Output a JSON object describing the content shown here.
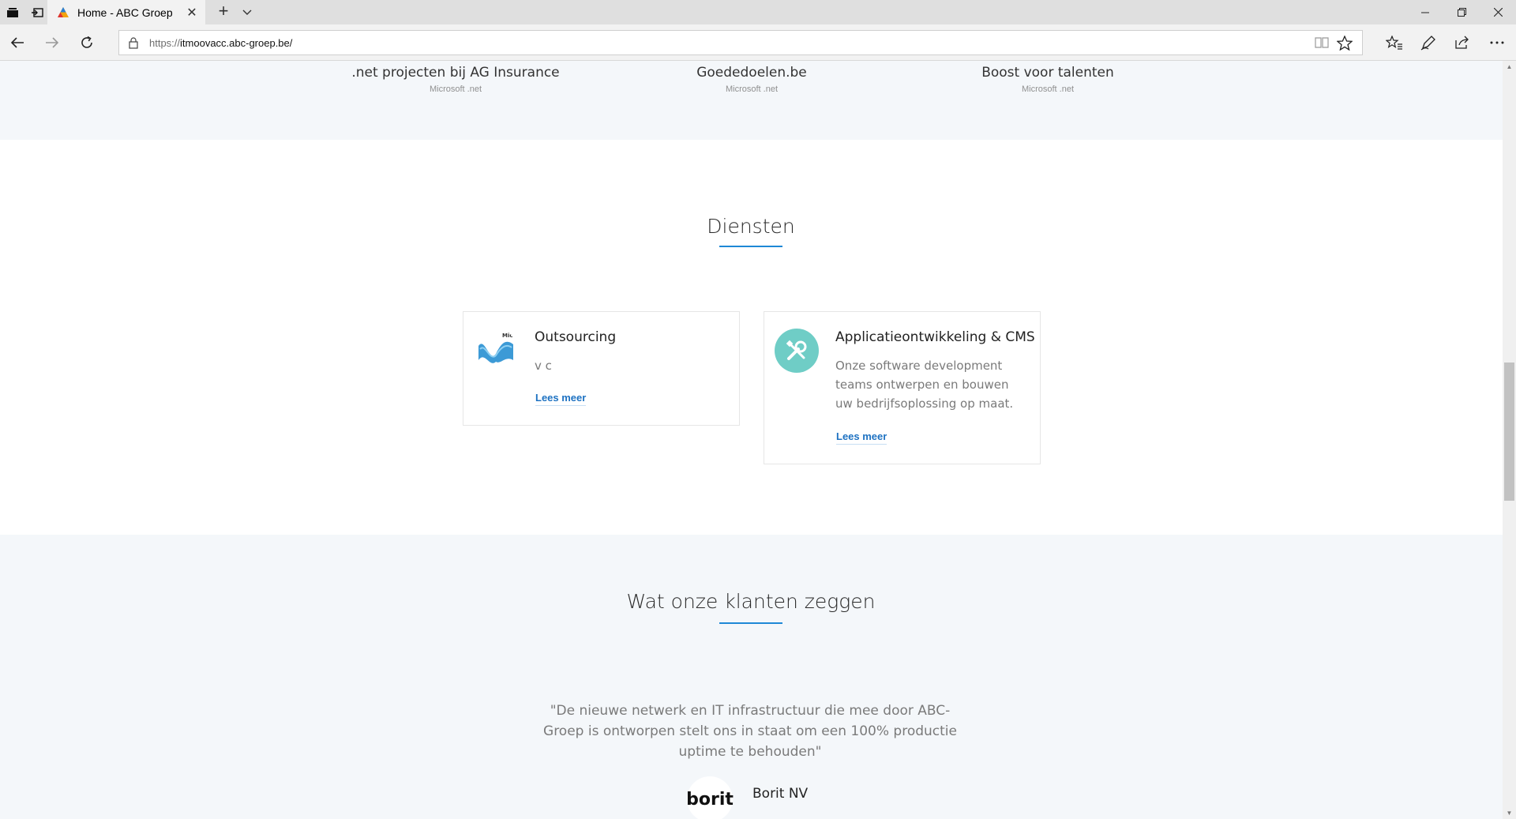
{
  "browser": {
    "tab_title": "Home - ABC Groep",
    "url_prefix": "https://",
    "url_host": "itmoovacc.abc-groep.be/"
  },
  "projects": [
    {
      "title": ".net projecten bij AG Insurance",
      "subtitle": "Microsoft .net"
    },
    {
      "title": "Goededoelen.be",
      "subtitle": "Microsoft .net"
    },
    {
      "title": "Boost voor talenten",
      "subtitle": "Microsoft .net"
    }
  ],
  "services": {
    "heading": "Diensten",
    "cards": [
      {
        "title": "Outsourcing",
        "text": "v c",
        "link": "Lees meer",
        "icon": "microsoft-net-logo-icon"
      },
      {
        "title": "Applicatieontwikkeling & CMS",
        "text": "Onze software development teams ontwerpen en bouwen uw bedrijfsoplossing op maat.",
        "link": "Lees meer",
        "icon": "tools-icon"
      }
    ]
  },
  "clients": {
    "heading": "Wat onze klanten zeggen",
    "quote": "\"De nieuwe netwerk en IT infrastructuur die mee door ABC-Groep is ontworpen stelt ons in staat om een 100% productie uptime te behouden\"",
    "client_logo_text": "borit",
    "client_name": "Borit NV"
  },
  "colors": {
    "accent": "#1e88d6",
    "link": "#1e72c2",
    "icon_teal": "#6fcdc6",
    "section_bg": "#f4f7fa"
  }
}
